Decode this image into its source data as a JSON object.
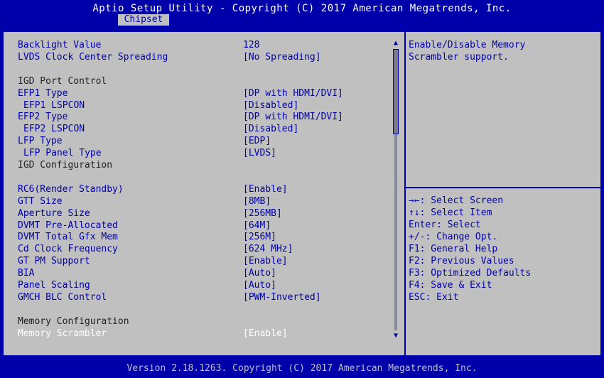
{
  "header": {
    "title": "Aptio Setup Utility - Copyright (C) 2017 American Megatrends, Inc.",
    "active_tab": "Chipset"
  },
  "settings": [
    {
      "label": "Backlight Value",
      "value": "128"
    },
    {
      "label": "LVDS Clock Center Spreading",
      "value": "[No Spreading]"
    },
    {
      "label": "IGD Port Control"
    },
    {
      "label": "EFP1 Type",
      "value": "[DP with HDMI/DVI]"
    },
    {
      "label": "EFP1 LSPCON",
      "value": "[Disabled]"
    },
    {
      "label": "EFP2 Type",
      "value": "[DP with HDMI/DVI]"
    },
    {
      "label": "EFP2 LSPCON",
      "value": "[Disabled]"
    },
    {
      "label": "LFP Type",
      "value": "[EDP]"
    },
    {
      "label": "LFP Panel Type",
      "value": "[LVDS]"
    },
    {
      "label": "IGD Configuration"
    },
    {
      "label": "RC6(Render Standby)",
      "value": "[Enable]"
    },
    {
      "label": "GTT Size",
      "value": "[8MB]"
    },
    {
      "label": "Aperture Size",
      "value": "[256MB]"
    },
    {
      "label": "DVMT Pre-Allocated",
      "value": "[64M]"
    },
    {
      "label": "DVMT Total Gfx Mem",
      "value": "[256M]"
    },
    {
      "label": "Cd Clock Frequency",
      "value": "[624 MHz]"
    },
    {
      "label": "GT PM Support",
      "value": "[Enable]"
    },
    {
      "label": "BIA",
      "value": "[Auto]"
    },
    {
      "label": "Panel Scaling",
      "value": "[Auto]"
    },
    {
      "label": "GMCH BLC Control",
      "value": "[PWM-Inverted]"
    },
    {
      "label": "Memory Configuration"
    },
    {
      "label": "Memory Scrambler",
      "value": "[Enable]"
    }
  ],
  "help_text": "Enable/Disable Memory\nScrambler support.",
  "key_help": [
    "→←: Select Screen",
    "↑↓: Select Item",
    "Enter: Select",
    "+/-: Change Opt.",
    "F1: General Help",
    "F2: Previous Values",
    "F3: Optimized Defaults",
    "F4: Save & Exit",
    "ESC: Exit"
  ],
  "footer": "Version 2.18.1263. Copyright (C) 2017 American Megatrends, Inc.",
  "colors": {
    "background": "#0000aa",
    "panel": "#c0c0c0",
    "text": "#0000aa",
    "selected": "#ffffff"
  },
  "icons": [
    "scroll-up-arrow-icon",
    "scroll-down-arrow-icon"
  ]
}
